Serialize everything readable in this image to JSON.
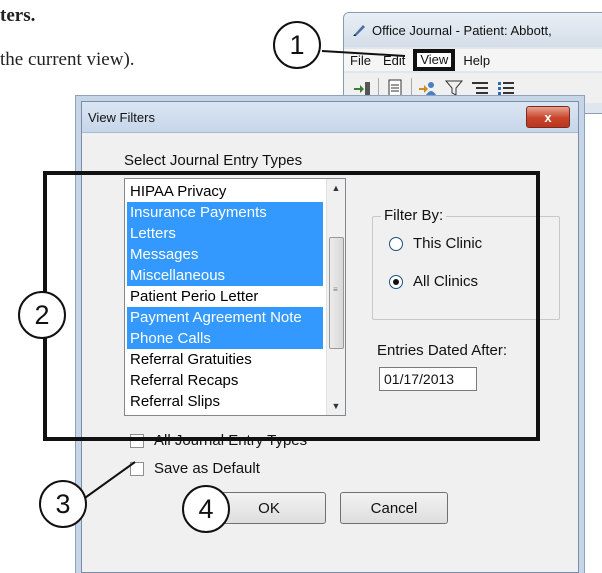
{
  "doc": {
    "line1": "ters.",
    "line2": "the current view)."
  },
  "background_window": {
    "title": "Office Journal - Patient: Abbott,",
    "menu": [
      "File",
      "Edit",
      "View",
      "Help"
    ]
  },
  "dialog": {
    "title": "View Filters",
    "close_label": "x",
    "entry_types_label": "Select Journal Entry Types",
    "entry_types": [
      {
        "label": "HIPAA Privacy",
        "selected": false
      },
      {
        "label": "Insurance Payments",
        "selected": true
      },
      {
        "label": "Letters",
        "selected": true
      },
      {
        "label": "Messages",
        "selected": true
      },
      {
        "label": "Miscellaneous",
        "selected": true
      },
      {
        "label": "Patient Perio Letter",
        "selected": false
      },
      {
        "label": "Payment Agreement Note",
        "selected": true
      },
      {
        "label": "Phone Calls",
        "selected": true
      },
      {
        "label": "Referral Gratuities",
        "selected": false
      },
      {
        "label": "Referral Recaps",
        "selected": false
      },
      {
        "label": "Referral Slips",
        "selected": false
      }
    ],
    "filter_by": {
      "legend": "Filter By:",
      "options": [
        {
          "label": "This Clinic",
          "checked": false
        },
        {
          "label": "All Clinics",
          "checked": true
        }
      ]
    },
    "entries_dated_after": {
      "label": "Entries Dated After:",
      "value": "01/17/2013"
    },
    "all_types_checkbox": {
      "label": "All Journal Entry Types",
      "checked": false
    },
    "save_default_checkbox": {
      "label": "Save as Default",
      "checked": false
    },
    "ok_label": "OK",
    "cancel_label": "Cancel"
  },
  "callouts": {
    "c1": "1",
    "c2": "2",
    "c3": "3",
    "c4": "4"
  },
  "colors": {
    "selection": "#3399ff",
    "close_button": "#c8452c"
  }
}
